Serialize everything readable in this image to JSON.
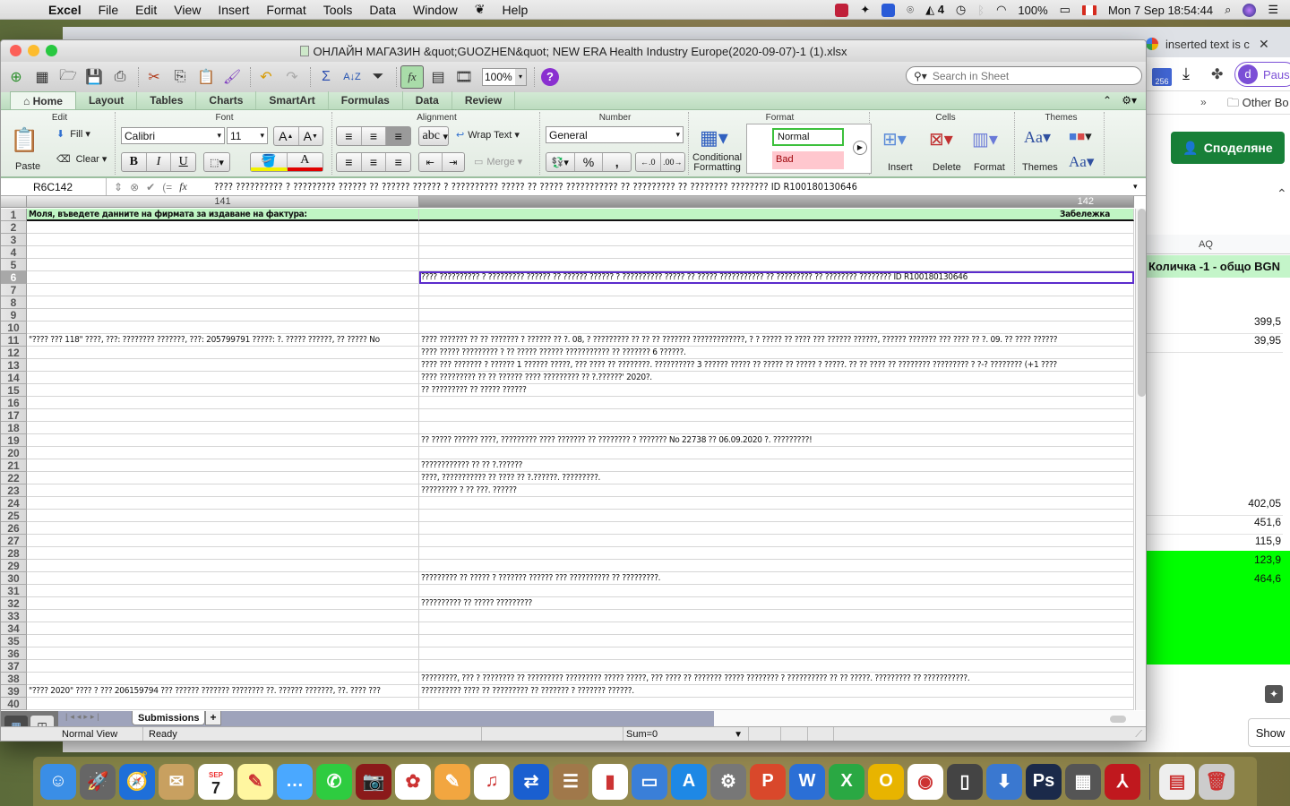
{
  "menubar": {
    "app_name": "Excel",
    "items": [
      "File",
      "Edit",
      "View",
      "Insert",
      "Format",
      "Tools",
      "Data",
      "Window",
      "Help"
    ],
    "status": {
      "battery": "100%",
      "date_time": "Mon 7 Sep  18:54:44",
      "notification_count": "4"
    }
  },
  "browser": {
    "active_tab_title": "inserted text is c",
    "mail_badge": "256",
    "profile_initial": "d",
    "profile_label": "Paus",
    "bookmarks_overflow": "»",
    "other_bookmarks": "Other Bo",
    "share_button": "Споделяне",
    "sheet": {
      "column_header": "AQ",
      "header_cell": "Количка -1 - общо BGN",
      "values": [
        "399,5",
        "39,95",
        "402,05",
        "451,6",
        "115,9",
        "123,9",
        "464,6"
      ],
      "highlight_color": "#00ff00"
    },
    "show_button": "Show"
  },
  "excel": {
    "window_title": "ОНЛАЙН МАГАЗИН &quot;GUOZHEN&quot; NEW ERA Health Industry Europe(2020-09-07)-1 (1).xlsx",
    "zoom": "100%",
    "search_placeholder": "Search in Sheet",
    "ribbon_tabs": [
      "Home",
      "Layout",
      "Tables",
      "Charts",
      "SmartArt",
      "Formulas",
      "Data",
      "Review"
    ],
    "active_tab": "Home",
    "ribbon": {
      "groups": {
        "edit": "Edit",
        "font": "Font",
        "alignment": "Alignment",
        "number": "Number",
        "format": "Format",
        "cells": "Cells",
        "themes": "Themes"
      },
      "paste": "Paste",
      "fill": "Fill",
      "clear": "Clear",
      "font_name": "Calibri",
      "font_size": "11",
      "wrap_text": "Wrap Text",
      "merge": "Merge",
      "number_format": "General",
      "conditional_formatting_1": "Conditional",
      "conditional_formatting_2": "Formatting",
      "style_normal": "Normal",
      "style_bad": "Bad",
      "insert": "Insert",
      "delete": "Delete",
      "format": "Format",
      "themes": "Themes",
      "abc": "abc",
      "percent": "%",
      "comma": ",",
      "bold": "B",
      "italic": "I",
      "underline": "U"
    },
    "formula_bar": {
      "cell_ref": "R6C142",
      "fx": "fx",
      "content": "???? ?????????? ? ????????? ?????? ?? ?????? ?????? ? ?????????? ????? ?? ????? ??????????? ?? ????????? ?? ???????? ???????? ID R100180130646"
    },
    "columns": [
      "141",
      "142"
    ],
    "rows": [
      {
        "n": "1",
        "a": "Моля, въведете данните на фирмата за издаване на фактура:",
        "b": "Забележка"
      },
      {
        "n": "2",
        "a": "",
        "b": ""
      },
      {
        "n": "3",
        "a": "",
        "b": ""
      },
      {
        "n": "4",
        "a": "",
        "b": ""
      },
      {
        "n": "5",
        "a": "",
        "b": ""
      },
      {
        "n": "6",
        "a": "",
        "b": "???? ?????????? ? ????????? ?????? ?? ?????? ?????? ? ?????????? ????? ?? ????? ??????????? ?? ????????? ?? ???????? ???????? ID R100180130646"
      },
      {
        "n": "7",
        "a": "",
        "b": ""
      },
      {
        "n": "8",
        "a": "",
        "b": ""
      },
      {
        "n": "9",
        "a": "",
        "b": ""
      },
      {
        "n": "10",
        "a": "",
        "b": ""
      },
      {
        "n": "11",
        "a": "\"???? ??? 118\" ????, ???: ???????? ???????, ???: 205799791   ?????: ?. ????? ??????, ?? ????? No",
        "b": "???? ??????? ?? ?? ??????? ? ?????? ?? ?. 08, ? ????????? ?? ?? ?? ??????? ?????????????, ? ? ????? ?? ???? ??? ?????? ??????, ?????? ??????? ??? ???? ?? ?. 09. ?? ???? ??????"
      },
      {
        "n": "12",
        "a": "",
        "b": "???? ????? ????????? ? ?? ????? ?????? ??????????? ?? ??????? 6 ??????."
      },
      {
        "n": "13",
        "a": "",
        "b": "???? ??? ??????? ? ?????? 1 ?????? ?????, ??? ???? ?? ????????. ?????????? 3 ?????? ????? ?? ????? ?? ????? ? ?????. ?? ?? ???? ?? ???????? ????????? ? ?-? ???????? (+1 ????"
      },
      {
        "n": "14",
        "a": "",
        "b": "???? ????????? ?? ?? ?????? ???? ????????? ?? ?.??????' 2020?."
      },
      {
        "n": "15",
        "a": "",
        "b": "?? ????????? ?? ????? ??????"
      },
      {
        "n": "16",
        "a": "",
        "b": ""
      },
      {
        "n": "17",
        "a": "",
        "b": ""
      },
      {
        "n": "18",
        "a": "",
        "b": ""
      },
      {
        "n": "19",
        "a": "",
        "b": "?? ????? ??????  ????, ????????? ???? ??????? ?? ???????? ? ??????? No 22738 ?? 06.09.2020 ?.  ?????????!"
      },
      {
        "n": "20",
        "a": "",
        "b": ""
      },
      {
        "n": "21",
        "a": "",
        "b": "???????????? ?? ?? ?.??????"
      },
      {
        "n": "22",
        "a": "",
        "b": "????, ??????????? ?? ???? ?? ?.??????. ?????????."
      },
      {
        "n": "23",
        "a": "",
        "b": "????????? ? ?? ???. ??????"
      },
      {
        "n": "24",
        "a": "",
        "b": ""
      },
      {
        "n": "25",
        "a": "",
        "b": ""
      },
      {
        "n": "26",
        "a": "",
        "b": ""
      },
      {
        "n": "27",
        "a": "",
        "b": ""
      },
      {
        "n": "28",
        "a": "",
        "b": ""
      },
      {
        "n": "29",
        "a": "",
        "b": ""
      },
      {
        "n": "30",
        "a": "",
        "b": "????????? ?? ????? ? ??????? ?????? ??? ?????????? ?? ?????????."
      },
      {
        "n": "31",
        "a": "",
        "b": ""
      },
      {
        "n": "32",
        "a": "",
        "b": "?????????? ?? ????? ?????????"
      },
      {
        "n": "33",
        "a": "",
        "b": ""
      },
      {
        "n": "34",
        "a": "",
        "b": ""
      },
      {
        "n": "35",
        "a": "",
        "b": ""
      },
      {
        "n": "36",
        "a": "",
        "b": ""
      },
      {
        "n": "37",
        "a": "",
        "b": ""
      },
      {
        "n": "38",
        "a": "",
        "b": "?????????, ??? ? ???????? ?? ????????? ????????? ????? ?????, ??? ???? ?? ??????? ????? ???????? ? ?????????? ?? ?? ?????. ????????? ?? ???????????."
      },
      {
        "n": "39",
        "a": "\"???? 2020\" ???? ? ??? 206159794 ??? ?????? ??????? ???????? ??. ?????? ???????, ??. ???? ???",
        "b": "?????????? ???? ?? ????????? ?? ??????? ? ??????? ??????."
      },
      {
        "n": "40",
        "a": "",
        "b": ""
      }
    ],
    "selected_row": "6",
    "sheet_tab": "Submissions",
    "add_sheet": "+",
    "status": {
      "view": "Normal View",
      "state": "Ready",
      "sum": "Sum=0"
    }
  },
  "dock": [
    "Finder",
    "Launchpad",
    "Safari",
    "Mail",
    "Calendar",
    "Notes",
    "Messages",
    "FaceTime",
    "Photo Booth",
    "Photos",
    "Pages",
    "iTunes",
    "TeamViewer",
    "Contacts",
    "Numbers",
    "Keynote",
    "App Store",
    "System Preferences",
    "PowerPoint",
    "Word",
    "Excel",
    "Outlook",
    "Chrome",
    "Parallels",
    "Downloader",
    "Photoshop",
    "Calculator",
    "Acrobat",
    "Downloads",
    "Trash"
  ],
  "calendar_month": "SEP",
  "calendar_day": "7"
}
